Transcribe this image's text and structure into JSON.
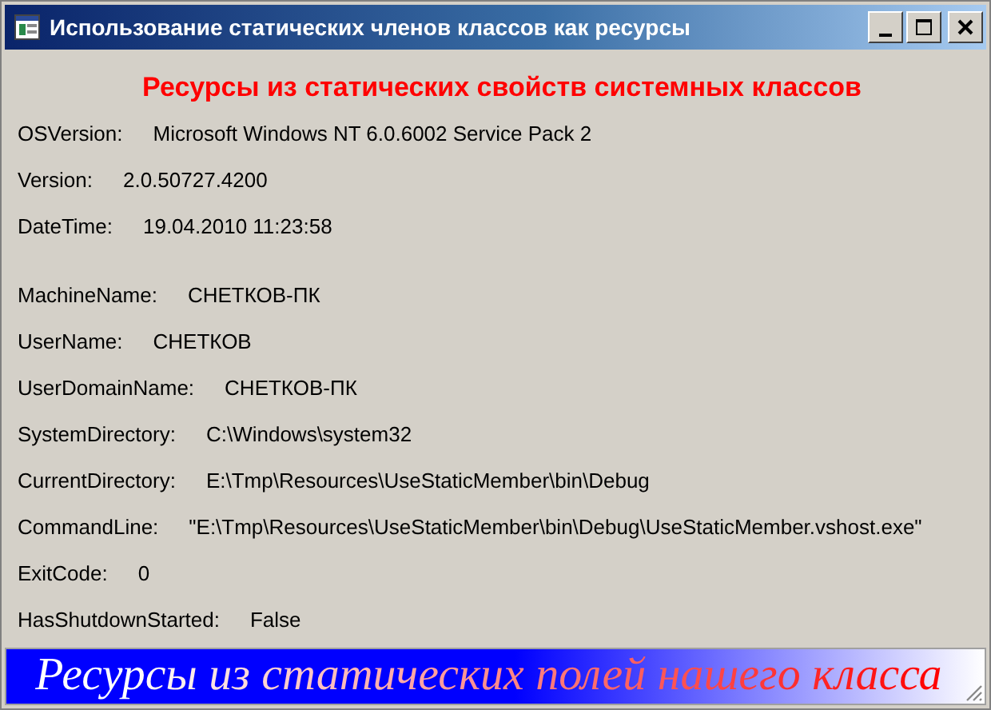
{
  "window": {
    "title": "Использование статических членов классов как ресурсы"
  },
  "heading": "Ресурсы из статических свойств системных классов",
  "groups": [
    {
      "rows": [
        {
          "label": "OSVersion:",
          "value": "Microsoft Windows NT 6.0.6002 Service Pack 2"
        },
        {
          "label": "Version:",
          "value": "2.0.50727.4200"
        },
        {
          "label": "DateTime:",
          "value": "19.04.2010 11:23:58"
        }
      ]
    },
    {
      "rows": [
        {
          "label": "MachineName:",
          "value": "СНЕТКОВ-ПК"
        },
        {
          "label": "UserName:",
          "value": "СНЕТКОВ"
        },
        {
          "label": "UserDomainName:",
          "value": "СНЕТКОВ-ПК"
        },
        {
          "label": "SystemDirectory:",
          "value": "C:\\Windows\\system32"
        },
        {
          "label": "CurrentDirectory:",
          "value": "E:\\Tmp\\Resources\\UseStaticMember\\bin\\Debug"
        },
        {
          "label": "CommandLine:",
          "value": "\"E:\\Tmp\\Resources\\UseStaticMember\\bin\\Debug\\UseStaticMember.vshost.exe\""
        },
        {
          "label": "ExitCode:",
          "value": "0"
        },
        {
          "label": "HasShutdownStarted:",
          "value": "False"
        }
      ]
    }
  ],
  "banner": "Ресурсы из статических полей нашего класса"
}
